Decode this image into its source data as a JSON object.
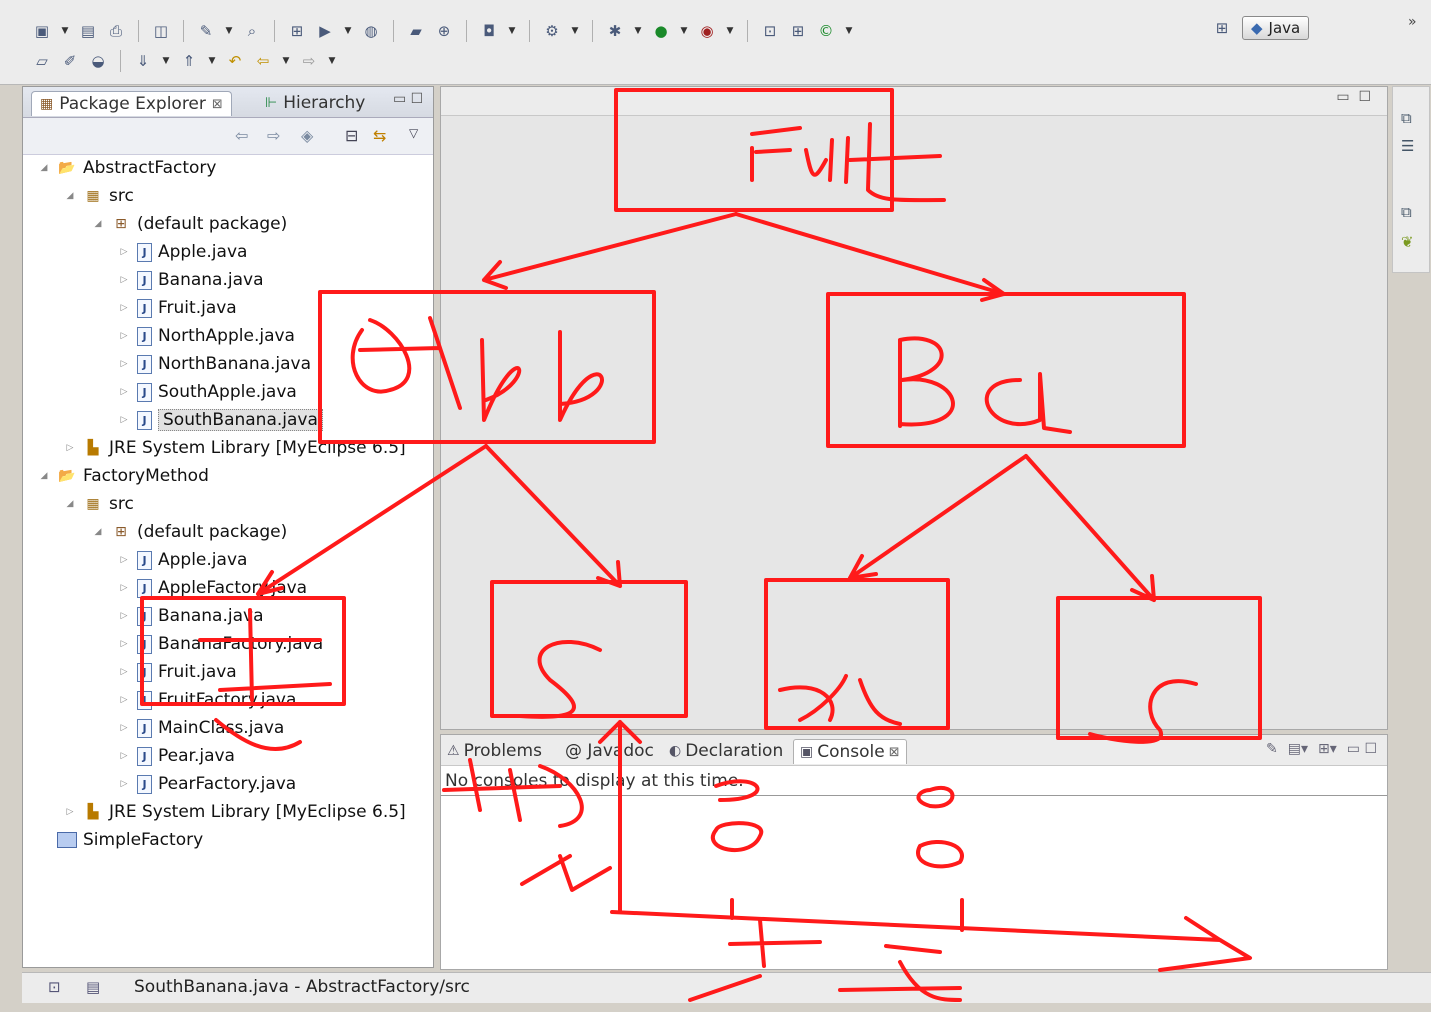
{
  "perspective": {
    "label": "Java"
  },
  "left_panel": {
    "tabs": [
      {
        "label": "Package Explorer"
      },
      {
        "label": "Hierarchy"
      }
    ],
    "tree": [
      {
        "label": "AbstractFactory",
        "type": "project"
      },
      {
        "label": "src",
        "type": "src"
      },
      {
        "label": "(default package)",
        "type": "package"
      },
      {
        "label": "Apple.java",
        "type": "java"
      },
      {
        "label": "Banana.java",
        "type": "java"
      },
      {
        "label": "Fruit.java",
        "type": "java"
      },
      {
        "label": "NorthApple.java",
        "type": "java"
      },
      {
        "label": "NorthBanana.java",
        "type": "java"
      },
      {
        "label": "SouthApple.java",
        "type": "java"
      },
      {
        "label": "SouthBanana.java",
        "type": "java"
      },
      {
        "label": "JRE System Library [MyEclipse 6.5]",
        "type": "lib"
      },
      {
        "label": "FactoryMethod",
        "type": "project"
      },
      {
        "label": "src",
        "type": "src"
      },
      {
        "label": "(default package)",
        "type": "package"
      },
      {
        "label": "Apple.java",
        "type": "java"
      },
      {
        "label": "AppleFactory.java",
        "type": "java"
      },
      {
        "label": "Banana.java",
        "type": "java"
      },
      {
        "label": "BananaFactory.java",
        "type": "java"
      },
      {
        "label": "Fruit.java",
        "type": "java"
      },
      {
        "label": "FruitFactory.java",
        "type": "java"
      },
      {
        "label": "MainClass.java",
        "type": "java"
      },
      {
        "label": "Pear.java",
        "type": "java"
      },
      {
        "label": "PearFactory.java",
        "type": "java"
      },
      {
        "label": "JRE System Library [MyEclipse 6.5]",
        "type": "lib"
      },
      {
        "label": "SimpleFactory",
        "type": "folder"
      }
    ]
  },
  "console_panel": {
    "tabs": [
      {
        "label": "Problems"
      },
      {
        "label": "@ Javadoc"
      },
      {
        "label": "Declaration"
      },
      {
        "label": "Console"
      }
    ],
    "message": "No consoles to display at this time."
  },
  "status_bar": {
    "text": "SouthBanana.java - AbstractFactory/src"
  },
  "annotations": {
    "color": "#ff1a1a",
    "box_fruit": "Fruit",
    "box_apple": "App",
    "box_banana": "Ba"
  }
}
